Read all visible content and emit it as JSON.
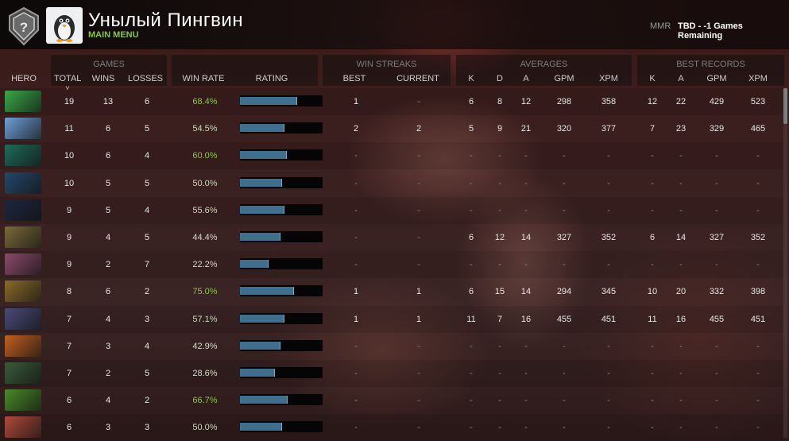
{
  "header": {
    "player_name": "Унылый Пингвин",
    "main_menu": "MAIN MENU",
    "mmr_label": "MMR",
    "mmr_value": "TBD - -1 Games Remaining",
    "rank_icon": "question-mark-shield-icon",
    "avatar_icon": "penguin-avatar-icon"
  },
  "groups": {
    "games": "GAMES",
    "win_streaks": "WIN STREAKS",
    "averages": "AVERAGES",
    "best_records": "BEST RECORDS"
  },
  "columns": {
    "hero": "HERO",
    "total": "TOTAL",
    "sort_indicator": "˅",
    "wins": "WINS",
    "losses": "LOSSES",
    "win_rate": "WIN RATE",
    "rating": "RATING",
    "best": "BEST",
    "current": "CURRENT",
    "avg_k": "K",
    "avg_d": "D",
    "avg_a": "A",
    "avg_gpm": "GPM",
    "avg_xpm": "XPM",
    "rec_k": "K",
    "rec_a": "A",
    "rec_gpm": "GPM",
    "rec_xpm": "XPM"
  },
  "colors": {
    "win_rate_high": "#8cc152",
    "win_rate_mid": "#c9d6b8",
    "win_rate_low": "#d8d8c8",
    "bar_fill": "#3f6f8c"
  },
  "rows": [
    {
      "total": "19",
      "wins": "13",
      "losses": "6",
      "win_rate": "68.4%",
      "rating": 0.68,
      "best": "1",
      "current": "-",
      "k": "6",
      "d": "8",
      "a": "12",
      "gpm": "298",
      "xpm": "358",
      "rk": "12",
      "ra": "22",
      "rgpm": "429",
      "rxpm": "523",
      "icon_color": "#3aa84a"
    },
    {
      "total": "11",
      "wins": "6",
      "losses": "5",
      "win_rate": "54.5%",
      "rating": 0.53,
      "best": "2",
      "current": "2",
      "k": "5",
      "d": "9",
      "a": "21",
      "gpm": "320",
      "xpm": "377",
      "rk": "7",
      "ra": "23",
      "rgpm": "329",
      "rxpm": "465",
      "icon_color": "#6f9fd8"
    },
    {
      "total": "10",
      "wins": "6",
      "losses": "4",
      "win_rate": "60.0%",
      "rating": 0.56,
      "best": "-",
      "current": "-",
      "k": "-",
      "d": "-",
      "a": "-",
      "gpm": "-",
      "xpm": "-",
      "rk": "-",
      "ra": "-",
      "rgpm": "-",
      "rxpm": "-",
      "icon_color": "#1f6a5a"
    },
    {
      "total": "10",
      "wins": "5",
      "losses": "5",
      "win_rate": "50.0%",
      "rating": 0.5,
      "best": "-",
      "current": "-",
      "k": "-",
      "d": "-",
      "a": "-",
      "gpm": "-",
      "xpm": "-",
      "rk": "-",
      "ra": "-",
      "rgpm": "-",
      "rxpm": "-",
      "icon_color": "#24486a"
    },
    {
      "total": "9",
      "wins": "5",
      "losses": "4",
      "win_rate": "55.6%",
      "rating": 0.53,
      "best": "-",
      "current": "-",
      "k": "-",
      "d": "-",
      "a": "-",
      "gpm": "-",
      "xpm": "-",
      "rk": "-",
      "ra": "-",
      "rgpm": "-",
      "rxpm": "-",
      "icon_color": "#1c2740"
    },
    {
      "total": "9",
      "wins": "4",
      "losses": "5",
      "win_rate": "44.4%",
      "rating": 0.48,
      "best": "-",
      "current": "-",
      "k": "6",
      "d": "12",
      "a": "14",
      "gpm": "327",
      "xpm": "352",
      "rk": "6",
      "ra": "14",
      "rgpm": "327",
      "rxpm": "352",
      "icon_color": "#7a6a3a"
    },
    {
      "total": "9",
      "wins": "2",
      "losses": "7",
      "win_rate": "22.2%",
      "rating": 0.34,
      "best": "-",
      "current": "-",
      "k": "-",
      "d": "-",
      "a": "-",
      "gpm": "-",
      "xpm": "-",
      "rk": "-",
      "ra": "-",
      "rgpm": "-",
      "rxpm": "-",
      "icon_color": "#8a4a6a"
    },
    {
      "total": "8",
      "wins": "6",
      "losses": "2",
      "win_rate": "75.0%",
      "rating": 0.64,
      "best": "1",
      "current": "1",
      "k": "6",
      "d": "15",
      "a": "14",
      "gpm": "294",
      "xpm": "345",
      "rk": "10",
      "ra": "20",
      "rgpm": "332",
      "rxpm": "398",
      "icon_color": "#8a6a2a"
    },
    {
      "total": "7",
      "wins": "4",
      "losses": "3",
      "win_rate": "57.1%",
      "rating": 0.53,
      "best": "1",
      "current": "1",
      "k": "11",
      "d": "7",
      "a": "16",
      "gpm": "455",
      "xpm": "451",
      "rk": "11",
      "ra": "16",
      "rgpm": "455",
      "rxpm": "451",
      "icon_color": "#4a4a7a"
    },
    {
      "total": "7",
      "wins": "3",
      "losses": "4",
      "win_rate": "42.9%",
      "rating": 0.48,
      "best": "-",
      "current": "-",
      "k": "-",
      "d": "-",
      "a": "-",
      "gpm": "-",
      "xpm": "-",
      "rk": "-",
      "ra": "-",
      "rgpm": "-",
      "rxpm": "-",
      "icon_color": "#c06020"
    },
    {
      "total": "7",
      "wins": "2",
      "losses": "5",
      "win_rate": "28.6%",
      "rating": 0.41,
      "best": "-",
      "current": "-",
      "k": "-",
      "d": "-",
      "a": "-",
      "gpm": "-",
      "xpm": "-",
      "rk": "-",
      "ra": "-",
      "rgpm": "-",
      "rxpm": "-",
      "icon_color": "#3a5a3a"
    },
    {
      "total": "6",
      "wins": "4",
      "losses": "2",
      "win_rate": "66.7%",
      "rating": 0.57,
      "best": "-",
      "current": "-",
      "k": "-",
      "d": "-",
      "a": "-",
      "gpm": "-",
      "xpm": "-",
      "rk": "-",
      "ra": "-",
      "rgpm": "-",
      "rxpm": "-",
      "icon_color": "#4a8a2a"
    },
    {
      "total": "6",
      "wins": "3",
      "losses": "3",
      "win_rate": "50.0%",
      "rating": 0.5,
      "best": "-",
      "current": "-",
      "k": "-",
      "d": "-",
      "a": "-",
      "gpm": "-",
      "xpm": "-",
      "rk": "-",
      "ra": "-",
      "rgpm": "-",
      "rxpm": "-",
      "icon_color": "#b04a3a"
    }
  ]
}
